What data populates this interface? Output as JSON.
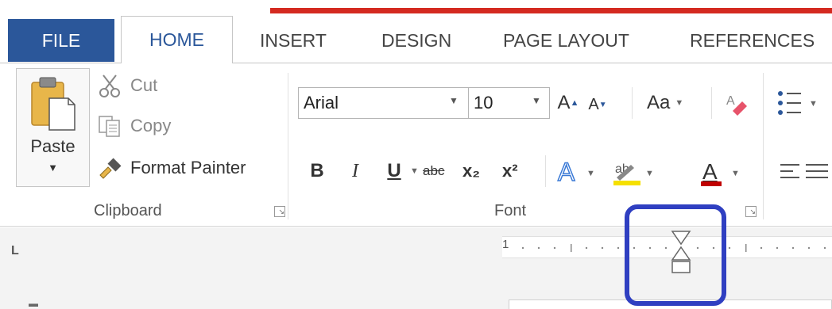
{
  "tabs": {
    "file": "FILE",
    "home": "HOME",
    "insert": "INSERT",
    "design": "DESIGN",
    "page_layout": "PAGE LAYOUT",
    "references": "REFERENCES"
  },
  "clipboard": {
    "paste": "Paste",
    "cut": "Cut",
    "copy": "Copy",
    "format_painter": "Format Painter",
    "group_label": "Clipboard"
  },
  "font": {
    "name": "Arial",
    "size": "10",
    "change_case": "Aa",
    "bold": "B",
    "italic": "I",
    "underline": "U",
    "strikethrough": "abc",
    "subscript": "x₂",
    "superscript": "x²",
    "group_label": "Font"
  },
  "ruler": {
    "tab_selector": "L",
    "start_number": "1"
  },
  "colors": {
    "file_tab": "#2b579a",
    "accent_red": "#d42a20",
    "highlight_box": "#2f3fc1",
    "highlight_yellow": "#f5e000",
    "font_color_red": "#c00000"
  },
  "icons": [
    "clipboard-icon",
    "scissors-icon",
    "copy-icon",
    "brush-icon",
    "eraser-icon",
    "text-effects-icon",
    "bullets-icon",
    "align-left-icon",
    "indent-marker-icon"
  ]
}
